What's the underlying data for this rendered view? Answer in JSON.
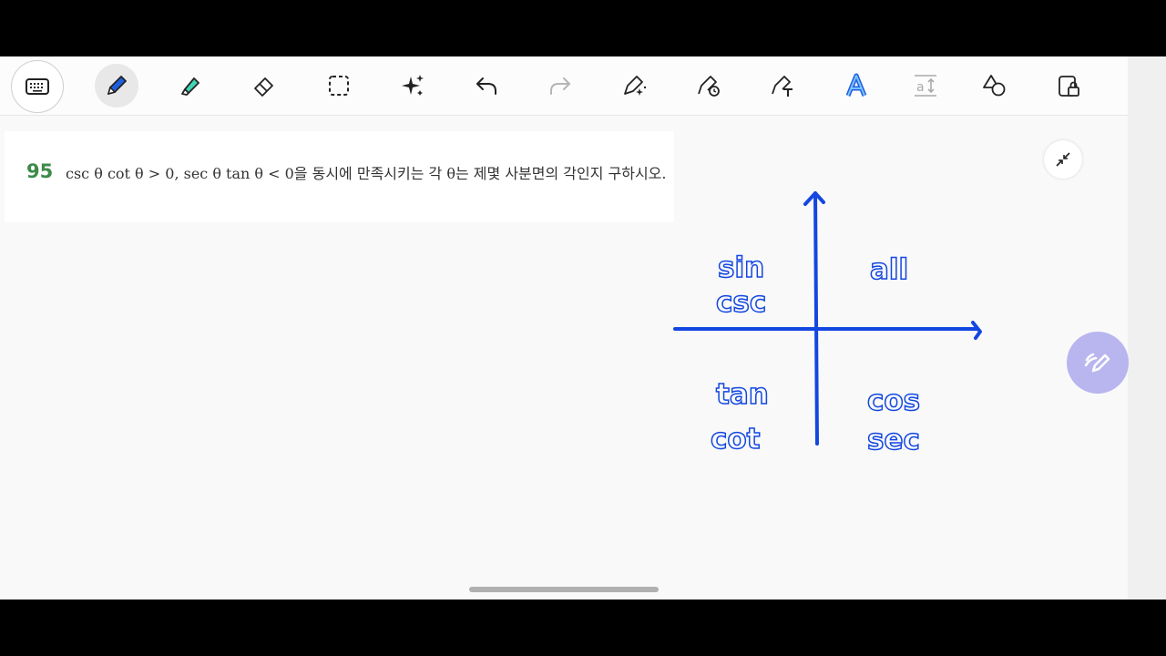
{
  "toolbar": {
    "items": [
      {
        "name": "keyboard-button",
        "icon": "keyboard-icon"
      },
      {
        "name": "pen-button",
        "icon": "pen-icon",
        "active": true
      },
      {
        "name": "highlighter-button",
        "icon": "highlighter-icon"
      },
      {
        "name": "eraser-button",
        "icon": "eraser-icon"
      },
      {
        "name": "lasso-select-button",
        "icon": "dashed-select-icon"
      },
      {
        "name": "magic-button",
        "icon": "sparkle-icon"
      },
      {
        "name": "undo-button",
        "icon": "undo-icon"
      },
      {
        "name": "redo-button",
        "icon": "redo-icon"
      },
      {
        "name": "pen-effects-button",
        "icon": "pen-sparkle-icon"
      },
      {
        "name": "pen-timer-button",
        "icon": "pen-clock-icon"
      },
      {
        "name": "pen-text-button",
        "icon": "pen-text-icon"
      },
      {
        "name": "text-style-button",
        "icon": "text-a-icon"
      },
      {
        "name": "text-size-button",
        "icon": "text-size-icon",
        "label": "a"
      },
      {
        "name": "shapes-button",
        "icon": "shapes-icon"
      },
      {
        "name": "lock-button",
        "icon": "lock-icon"
      }
    ]
  },
  "problem": {
    "number": "95",
    "text": "csc θ cot θ > 0, sec θ tan θ < 0을 동시에 만족시키는 각 θ는 제몇 사분면의 각인지 구하시오."
  },
  "handwriting": {
    "q2": [
      "sin",
      "csc"
    ],
    "q1": [
      "all"
    ],
    "q3": [
      "tan",
      "cot"
    ],
    "q4": [
      "cos",
      "sec"
    ],
    "ink_color": "#1347e0"
  },
  "fab": {
    "icon": "pencil-wave-icon",
    "color": "#b8b5ef"
  },
  "collapse": {
    "icon": "collapse-arrows-icon"
  }
}
